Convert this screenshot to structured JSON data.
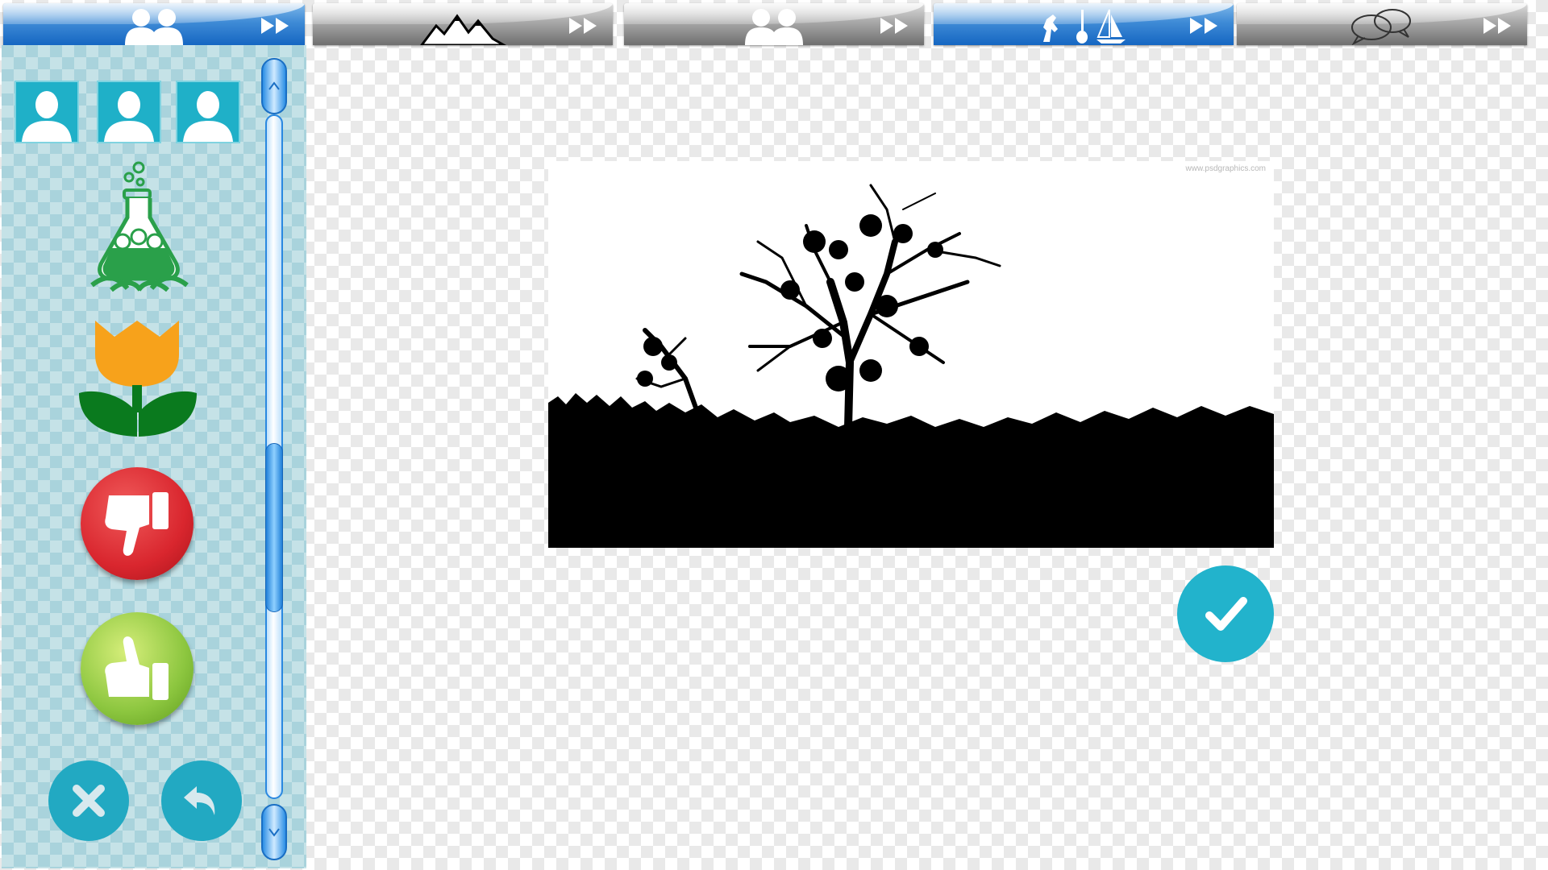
{
  "tabs": [
    {
      "name": "people-pair",
      "icon": "two-people-icon",
      "active": true
    },
    {
      "name": "landscape",
      "icon": "mountains-icon",
      "active": false
    },
    {
      "name": "people-pair-2",
      "icon": "two-people-icon",
      "active": false
    },
    {
      "name": "hobbies",
      "icon": "horse-guitar-boat-icon",
      "active": true
    },
    {
      "name": "speech",
      "icon": "speech-bubbles-icon",
      "active": false
    }
  ],
  "panel": {
    "avatars": [
      "person-icon",
      "person-icon",
      "person-icon"
    ],
    "tools": [
      "science-flask-icon",
      "tulip-icon",
      "thumbs-down-icon",
      "thumbs-up-icon"
    ],
    "bottom_actions": [
      "close-icon",
      "undo-icon"
    ]
  },
  "canvas": {
    "watermark": "www.psdgraphics.com",
    "image_subject": "tree-silhouette"
  },
  "colors": {
    "tab_active": "#1566c2",
    "tab_inactive": "#8a8a8a",
    "panel_bg": "#a9d3dc",
    "accent_teal": "#22b3cc",
    "dislike_red": "#d9262e",
    "like_green": "#8cc63f",
    "tulip_orange": "#f7a21b",
    "tulip_green": "#0a7a1e"
  }
}
